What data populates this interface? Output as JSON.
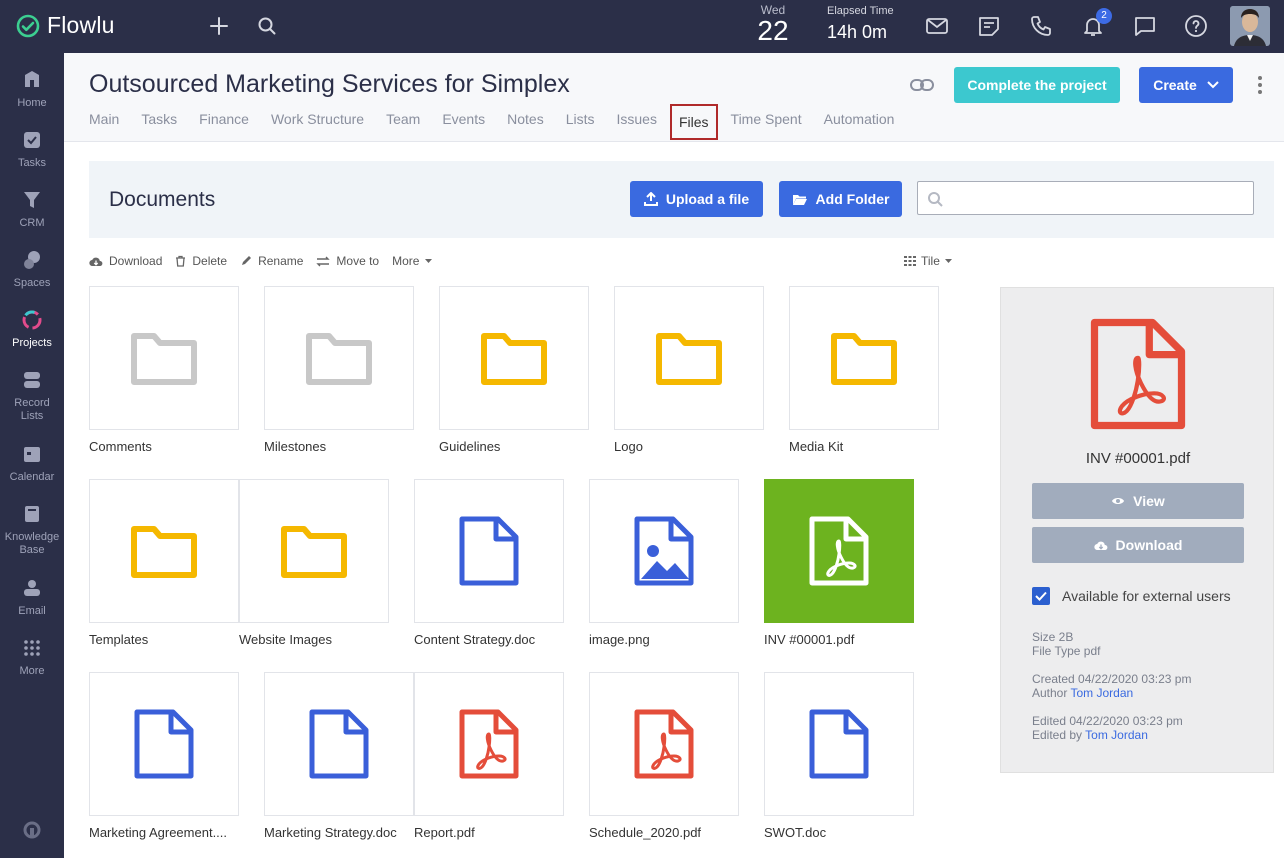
{
  "app": {
    "name": "Flowlu"
  },
  "topbar": {
    "day_name": "Wed",
    "day_number": "22",
    "elapsed_label": "Elapsed Time",
    "elapsed_value": "14h 0m",
    "notifications_count": "2"
  },
  "sidebar": {
    "items": [
      {
        "label": "Home",
        "icon": "home-icon"
      },
      {
        "label": "Tasks",
        "icon": "tasks-icon"
      },
      {
        "label": "CRM",
        "icon": "crm-icon"
      },
      {
        "label": "Spaces",
        "icon": "spaces-icon"
      },
      {
        "label": "Projects",
        "icon": "projects-icon"
      },
      {
        "label": "Record Lists",
        "icon": "record-lists-icon"
      },
      {
        "label": "Calendar",
        "icon": "calendar-icon"
      },
      {
        "label": "Knowledge Base",
        "icon": "knowledge-base-icon"
      },
      {
        "label": "Email",
        "icon": "email-icon"
      },
      {
        "label": "More",
        "icon": "more-grid-icon"
      }
    ]
  },
  "header": {
    "title": "Outsourced Marketing Services for Simplex",
    "complete_label": "Complete the project",
    "create_label": "Create",
    "tabs": [
      "Main",
      "Tasks",
      "Finance",
      "Work Structure",
      "Team",
      "Events",
      "Notes",
      "Lists",
      "Issues",
      "Files",
      "Time Spent",
      "Automation"
    ],
    "active_tab": "Files"
  },
  "documents": {
    "title": "Documents",
    "upload_label": "Upload a file",
    "add_folder_label": "Add Folder",
    "search_placeholder": ""
  },
  "actions": {
    "download": "Download",
    "delete": "Delete",
    "rename": "Rename",
    "move_to": "Move to",
    "more": "More",
    "view_mode": "Tile"
  },
  "files": [
    {
      "name": "Comments",
      "kind": "folder-gray"
    },
    {
      "name": "Milestones",
      "kind": "folder-gray"
    },
    {
      "name": "Guidelines",
      "kind": "folder"
    },
    {
      "name": "Logo",
      "kind": "folder"
    },
    {
      "name": "Media Kit",
      "kind": "folder"
    },
    {
      "name": "Templates",
      "kind": "folder"
    },
    {
      "name": "Website Images",
      "kind": "folder"
    },
    {
      "name": "Content Strategy.doc",
      "kind": "doc"
    },
    {
      "name": "image.png",
      "kind": "image"
    },
    {
      "name": "INV #00001.pdf",
      "kind": "pdf-selected"
    },
    {
      "name": "Marketing Agreement....",
      "kind": "doc"
    },
    {
      "name": "Marketing Strategy.doc",
      "kind": "doc"
    },
    {
      "name": "Report.pdf",
      "kind": "pdf"
    },
    {
      "name": "Schedule_2020.pdf",
      "kind": "pdf"
    },
    {
      "name": "SWOT.doc",
      "kind": "doc"
    }
  ],
  "details": {
    "file_name": "INV #00001.pdf",
    "view_label": "View",
    "download_label": "Download",
    "external_label": "Available for external users",
    "size": "Size 2B",
    "file_type": "File Type pdf",
    "created": "Created 04/22/2020 03:23 pm",
    "author_prefix": "Author",
    "author": "Tom Jordan",
    "edited": "Edited 04/22/2020 03:23 pm",
    "edited_by_prefix": "Edited by",
    "edited_by": "Tom Jordan"
  },
  "colors": {
    "nav_bg": "#2b2f48",
    "accent_blue": "#3a6ae0",
    "accent_teal": "#3cc8cf",
    "folder_yellow": "#f5b800",
    "pdf_red": "#e44d3a",
    "selected_green": "#6db31f"
  }
}
